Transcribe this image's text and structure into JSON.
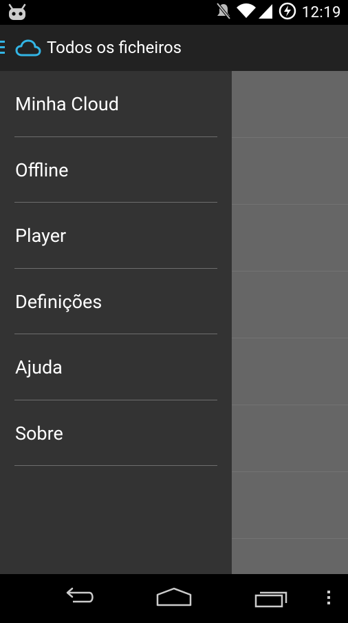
{
  "status_bar": {
    "time": "12:19",
    "icons": [
      "android-notification-icon",
      "mute-icon",
      "wifi-icon",
      "cell-signal-icon",
      "sync-icon"
    ]
  },
  "action_bar": {
    "title": "Todos os ficheiros",
    "menu_icon": "hamburger-icon",
    "app_icon": "cloud-icon",
    "accent_color": "#33b5e5"
  },
  "drawer": {
    "items": [
      {
        "label": "Minha Cloud"
      },
      {
        "label": "Offline"
      },
      {
        "label": "Player"
      },
      {
        "label": "Definições"
      },
      {
        "label": "Ajuda"
      },
      {
        "label": "Sobre"
      }
    ]
  },
  "nav_bar": {
    "buttons": [
      "back-icon",
      "home-icon",
      "recents-icon",
      "overflow-menu-icon"
    ]
  }
}
